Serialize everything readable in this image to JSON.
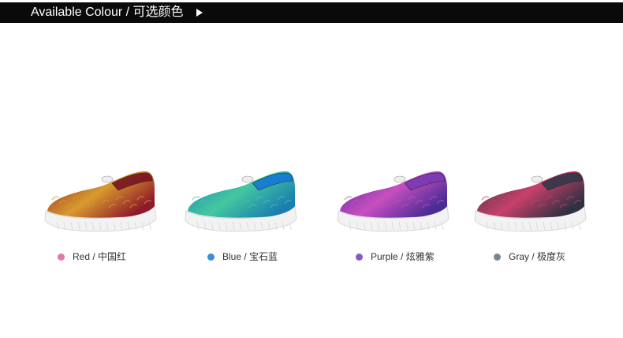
{
  "header": {
    "title": "Available Colour / 可选颜色",
    "arrow_icon": "play-triangle-icon"
  },
  "colors": [
    {
      "label": "Red / 中国红",
      "dot": "#e07aa8",
      "upper": "#8e1a2a",
      "accent": "#d99a2e",
      "collar": "#7a1420",
      "sole": "#f2f2f2"
    },
    {
      "label": "Blue / 宝石蓝",
      "dot": "#3a8fd8",
      "upper": "#1a7fb0",
      "accent": "#44c7a0",
      "collar": "#1478d6",
      "sole": "#f2f2f2"
    },
    {
      "label": "Purple / 炫雅紫",
      "dot": "#8a5ac4",
      "upper": "#4a2c95",
      "accent": "#c84fc0",
      "collar": "#7a3ab5",
      "sole": "#f2f2f2"
    },
    {
      "label": "Gray / 极度灰",
      "dot": "#7b8494",
      "upper": "#2e3142",
      "accent": "#c8406a",
      "collar": "#34384a",
      "sole": "#f2f2f2"
    }
  ]
}
